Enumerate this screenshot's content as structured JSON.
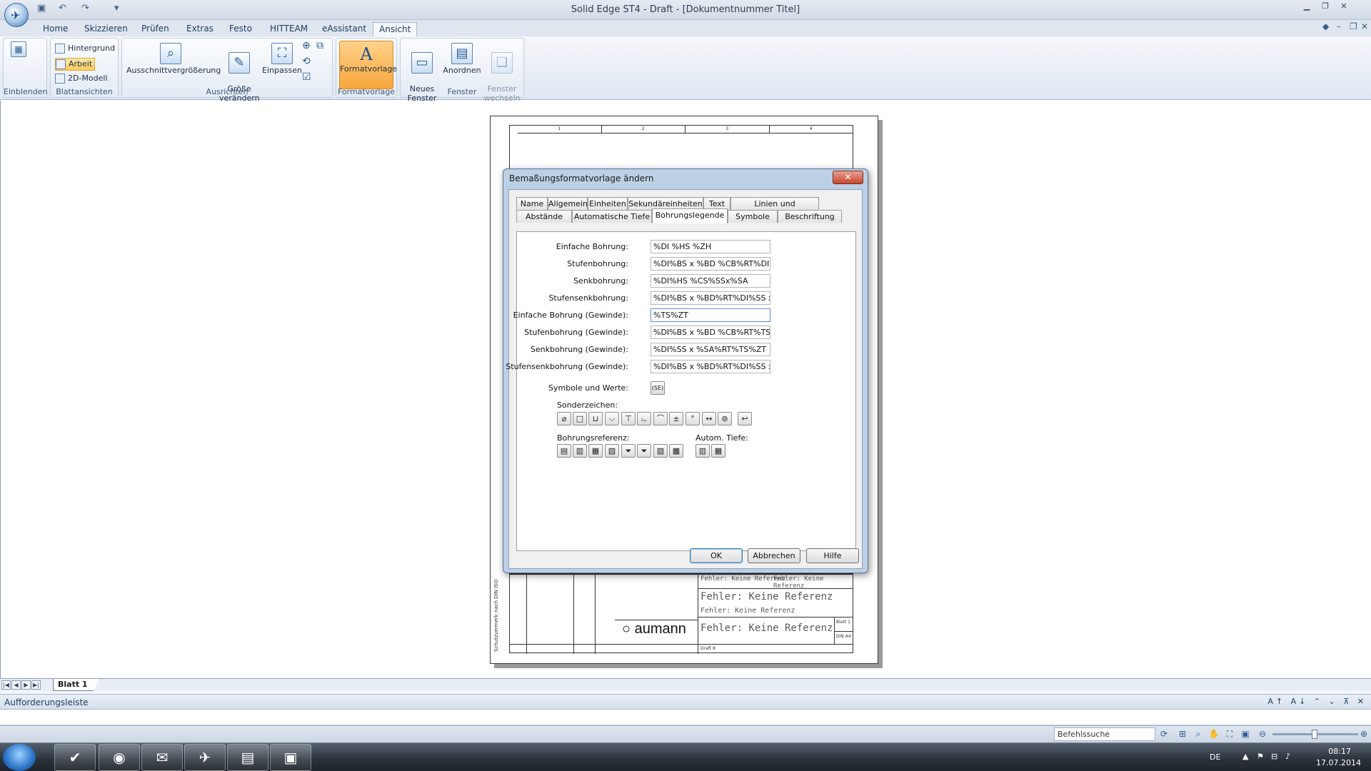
{
  "window": {
    "title": "Solid Edge ST4 - Draft - [Dokumentnummer Titel]"
  },
  "ribbon": {
    "tabs": [
      "Home",
      "Skizzieren",
      "Prüfen",
      "Extras",
      "Festo",
      "HITTEAM",
      "eAssistant",
      "Ansicht"
    ],
    "active_tab": "Ansicht",
    "groups": {
      "einblenden": {
        "label": "Einblenden"
      },
      "blattansichten": {
        "label": "Blattansichten",
        "items": [
          "Hintergrund",
          "Arbeit",
          "2D-Modell"
        ],
        "active": "Arbeit"
      },
      "ausrichten": {
        "label": "Ausrichten",
        "buttons": [
          "Ausschnittvergrößerung",
          "Größe\nverändern",
          "Einpassen"
        ]
      },
      "formatvorlage": {
        "label": "Formatvorlage",
        "button": "Formatvorlage"
      },
      "fenster": {
        "label": "Fenster",
        "buttons": [
          "Neues\nFenster",
          "Anordnen",
          "Fenster\nwechseln"
        ]
      }
    }
  },
  "drawing": {
    "zones": [
      "1",
      "2",
      "3",
      "4"
    ],
    "title_block": {
      "error_text": "Fehler: Keine Referenz",
      "company": "aumann",
      "sheet": "Blatt 1",
      "format": "DIN A4",
      "draft_name": "Draft 8",
      "vertical_note": "Schutzvermerk nach DIN ISO"
    }
  },
  "dialog": {
    "title": "Bemaßungsformatvorlage ändern",
    "tabs_row1": [
      "Name",
      "Allgemein",
      "Einheiten",
      "Sekundäreinheiten",
      "Text",
      "Linien und Koordinaten"
    ],
    "tabs_row2": [
      "Abstände",
      "Automatische Tiefe",
      "Bohrungslegende",
      "Symbole",
      "Beschriftung"
    ],
    "active_tab": "Bohrungslegende",
    "fields": [
      {
        "label": "Einfache Bohrung:",
        "value": "%DI %HS %ZH"
      },
      {
        "label": "Stufenbohrung:",
        "value": "%DI%BS x %BD %CB%RT%DI%HS"
      },
      {
        "label": "Senkbohrung:",
        "value": "%DI%HS %CS%SSx%SA"
      },
      {
        "label": "Stufensenkbohrung:",
        "value": "%DI%BS x %BD%RT%DI%SS x %S"
      },
      {
        "label": "Einfache Bohrung (Gewinde):",
        "value": "%TS%ZT"
      },
      {
        "label": "Stufenbohrung (Gewinde):",
        "value": "%DI%BS x %BD %CB%RT%TS%ZT"
      },
      {
        "label": "Senkbohrung (Gewinde):",
        "value": "%DI%SS x %SA%RT%TS%ZT"
      },
      {
        "label": "Stufensenkbohrung (Gewinde):",
        "value": "%DI%BS x %BD%RT%DI%SS x %S"
      }
    ],
    "symbols_label": "Symbole und Werte:",
    "symbols_button": "(SE)",
    "special_chars_label": "Sonderzeichen:",
    "special_chars": [
      "⌀",
      "□",
      "⊔",
      "⌵",
      "⊤",
      "⌳",
      "⌒",
      "±",
      "°",
      "↔",
      "⊚",
      "↩"
    ],
    "hole_ref_label": "Bohrungsreferenz:",
    "hole_refs": [
      "▤",
      "▥",
      "▦",
      "▧",
      "⏷",
      "⏷",
      "▨",
      "▩"
    ],
    "auto_depth_label": "Autom. Tiefe:",
    "auto_depth": [
      "▥",
      "▦"
    ],
    "buttons": {
      "ok": "OK",
      "cancel": "Abbrechen",
      "help": "Hilfe"
    }
  },
  "sheet_tabs": {
    "active": "Blatt 1"
  },
  "prompt": {
    "title": "Aufforderungsleiste"
  },
  "status": {
    "search_placeholder": "Befehlssuche"
  },
  "taskbar": {
    "language": "DE",
    "time": "08:17",
    "date": "17.07.2014"
  }
}
